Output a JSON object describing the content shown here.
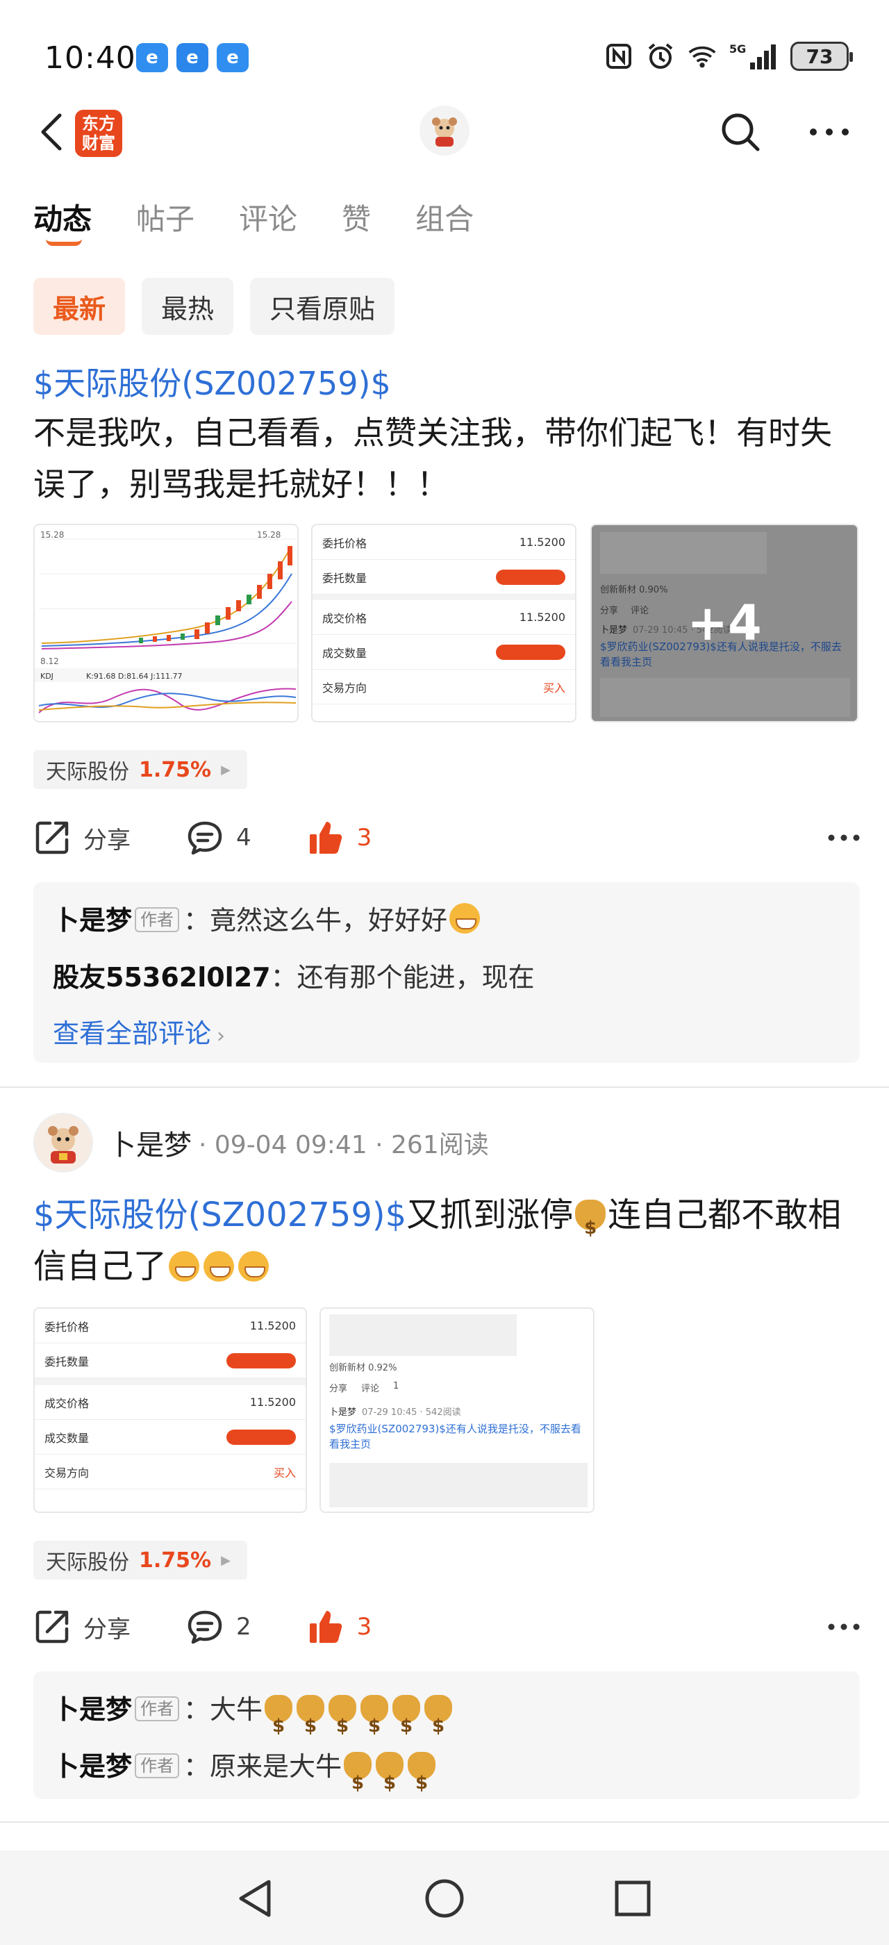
{
  "status_bar": {
    "time": "10:40",
    "app_icons": [
      "e",
      "e",
      "e"
    ],
    "battery": "73"
  },
  "nav": {
    "logo_line1": "东方",
    "logo_line2": "财富"
  },
  "tabs": [
    {
      "label": "动态",
      "active": true
    },
    {
      "label": "帖子",
      "active": false
    },
    {
      "label": "评论",
      "active": false
    },
    {
      "label": "赞",
      "active": false
    },
    {
      "label": "组合",
      "active": false
    }
  ],
  "filters": [
    {
      "label": "最新",
      "active": true
    },
    {
      "label": "最热",
      "active": false
    },
    {
      "label": "只看原贴",
      "active": false
    }
  ],
  "post1": {
    "stock_link": "$天际股份(SZ002759)$",
    "body": "不是我吹，自己看看，点赞关注我，带你们起飞！有时失误了，别骂我是托就好！！！",
    "more_images": "+4",
    "chart_labels": {
      "high": "15.28",
      "high2": "15.28",
      "low": "8.12",
      "kdj": "KDJ",
      "kdj_values": "K:91.68 D:81.64 J:111.77"
    },
    "order": {
      "entrust_price_label": "委托价格",
      "entrust_price": "11.5200",
      "entrust_qty_label": "委托数量",
      "deal_price_label": "成交价格",
      "deal_price": "11.5200",
      "deal_qty_label": "成交数量",
      "direction_label": "交易方向",
      "direction": "买入"
    },
    "thumb3": {
      "line1": "创新新材 0.90%",
      "share": "分享",
      "comment": "评论",
      "author": "卜是梦",
      "time": "07-29 10:45 · 542阅读",
      "text": "$罗欣药业(SZ002793)$还有人说我是托没，不服去看看我主页"
    },
    "stock_tag": {
      "name": "天际股份",
      "pct": "1.75%"
    },
    "actions": {
      "share": "分享",
      "comments": "4",
      "likes": "3"
    },
    "comments": [
      {
        "user": "卜是梦",
        "badge": "作者",
        "text": "竟然这么牛，好好好"
      },
      {
        "user": "股友55362l0l27",
        "text": "还有那个能进，现在"
      }
    ],
    "view_all": "查看全部评论"
  },
  "post2": {
    "author": "卜是梦",
    "meta": "· 09-04 09:41 · 261阅读",
    "stock_link": "$天际股份(SZ002759)$",
    "body_a": "又抓到涨停",
    "body_b": "连自己都不敢相信自己了",
    "order": {
      "entrust_price_label": "委托价格",
      "entrust_price": "11.5200",
      "entrust_qty_label": "委托数量",
      "deal_price_label": "成交价格",
      "deal_price": "11.5200",
      "deal_qty_label": "成交数量",
      "direction_label": "交易方向",
      "direction": "买入"
    },
    "thumb2": {
      "line1": "创新新材 0.92%",
      "share": "分享",
      "comment": "评论",
      "likes": "1",
      "author": "卜是梦",
      "time": "07-29 10:45 · 542阅读",
      "text": "$罗欣药业(SZ002793)$还有人说我是托没，不服去看看我主页"
    },
    "stock_tag": {
      "name": "天际股份",
      "pct": "1.75%"
    },
    "actions": {
      "share": "分享",
      "comments": "2",
      "likes": "3"
    },
    "comments": [
      {
        "user": "卜是梦",
        "badge": "作者",
        "text": "大牛"
      },
      {
        "user": "卜是梦",
        "badge": "作者",
        "text": "原来是大牛"
      }
    ]
  },
  "colors": {
    "accent": "#e8471d",
    "link": "#2e6fd6",
    "tab_underline": "#ef6a2a"
  }
}
